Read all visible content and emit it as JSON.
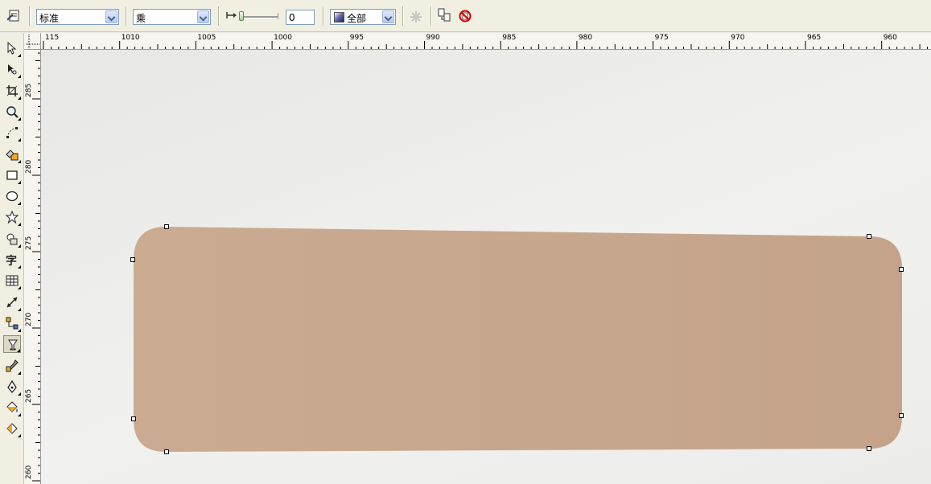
{
  "propertyBar": {
    "presetCombo": {
      "value": "标准"
    },
    "modeCombo": {
      "value": "乘"
    },
    "amount": {
      "value": "0"
    },
    "scopeCombo": {
      "value": "全部"
    }
  },
  "toolbox": {
    "activeIndex": 14,
    "tools": [
      "pick-tool-icon",
      "shape-tool-icon",
      "crop-tool-icon",
      "zoom-tool-icon",
      "freehand-tool-icon",
      "smart-fill-tool-icon",
      "rectangle-tool-icon",
      "ellipse-tool-icon",
      "polygon-tool-icon",
      "basic-shapes-tool-icon",
      "text-tool-icon",
      "table-tool-icon",
      "dimension-tool-icon",
      "connector-tool-icon",
      "transparency-tool-icon",
      "eyedropper-tool-icon",
      "outline-tool-icon",
      "fill-tool-icon",
      "interactive-fill-tool-icon"
    ]
  },
  "rulers": {
    "horizontalLabels": [
      "115",
      "1010",
      "1005",
      "1000",
      "995",
      "990",
      "985",
      "980",
      "975",
      "970",
      "965",
      "960"
    ],
    "verticalLabels": [
      "285",
      "280",
      "275",
      "270",
      "265",
      "260"
    ]
  },
  "colors": {
    "shapeFillLeft": "#caab91",
    "shapeFillRight": "#c4a38a",
    "toolbarBg": "#f1efe2"
  }
}
